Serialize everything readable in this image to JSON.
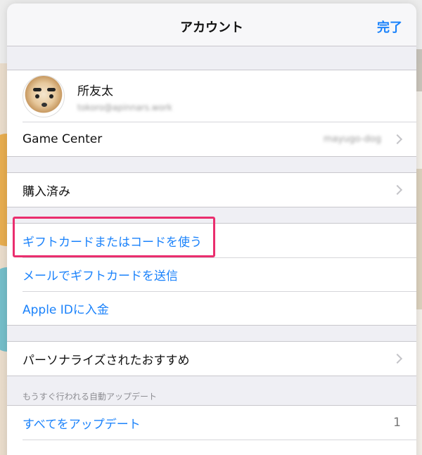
{
  "navbar": {
    "title": "アカウント",
    "done_label": "完了"
  },
  "profile": {
    "name": "所友太",
    "email": "tokoro@apinnars.work",
    "avatar_icon": "dog-avatar"
  },
  "game_center": {
    "label": "Game Center",
    "detail": "mayugo-dog"
  },
  "purchased": {
    "label": "購入済み"
  },
  "gift": {
    "redeem_label": "ギフトカードまたはコードを使う",
    "send_label": "メールでギフトカードを送信",
    "add_funds_label": "Apple IDに入金"
  },
  "personalized": {
    "label": "パーソナライズされたおすすめ"
  },
  "updates": {
    "header": "もうすぐ行われる自動アップデート",
    "update_all_label": "すべてをアップデート",
    "count": "1"
  },
  "colors": {
    "accent": "#1a82fb",
    "highlight": "#ea2e6e"
  }
}
